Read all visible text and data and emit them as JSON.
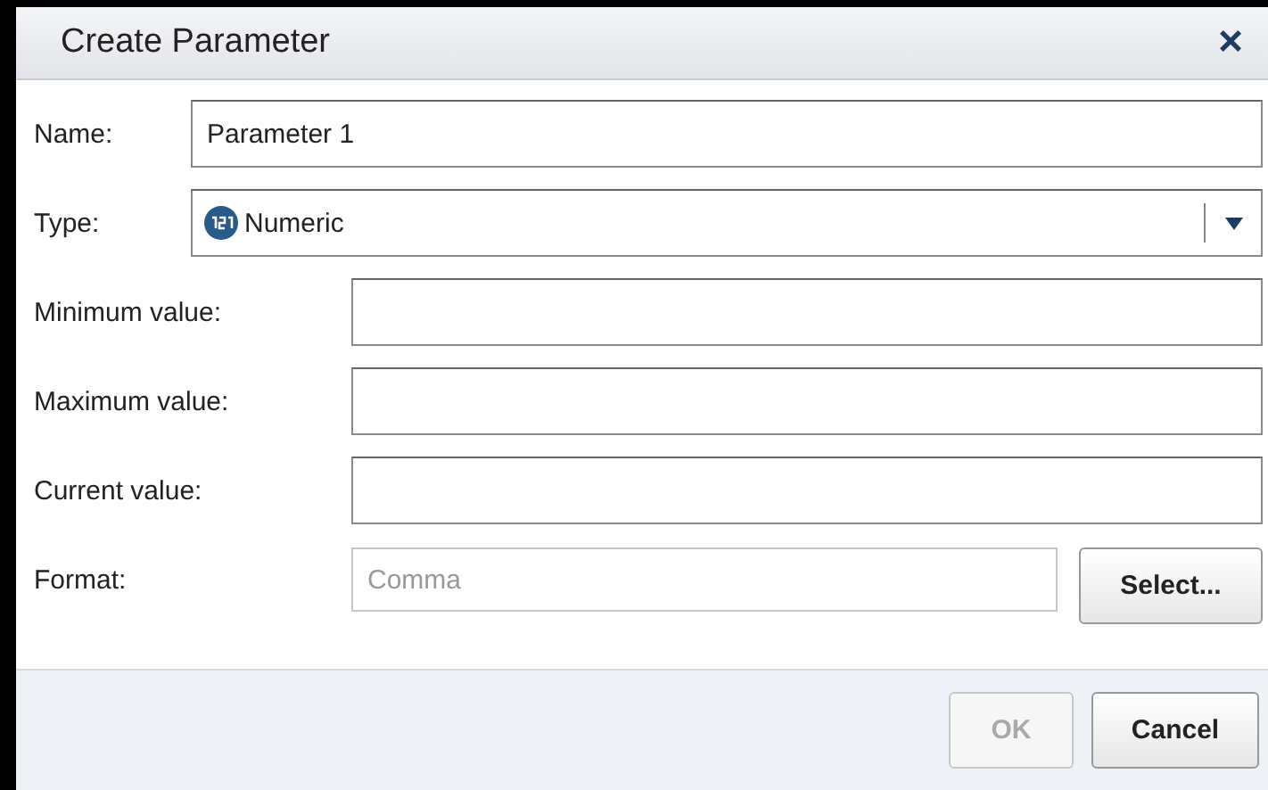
{
  "window": {
    "title": "Create Parameter",
    "close": "×"
  },
  "fields": [
    {
      "kind": "text",
      "label": "Name:",
      "value": "Parameter 1"
    },
    {
      "kind": "dropdown",
      "label": "Type:",
      "value": "Numeric"
    },
    {
      "kind": "text",
      "label": "Minimum value:"
    },
    {
      "kind": "text",
      "label": "Maximum value:"
    },
    {
      "kind": "text",
      "label": "Current value:"
    },
    {
      "kind": "format",
      "label": "Format:",
      "placeholder": "Comma",
      "disabled": true,
      "button": "Select..."
    }
  ],
  "buttons": [
    {
      "label": "OK",
      "disabled": true
    },
    {
      "label": "Cancel",
      "disabled": false
    }
  ]
}
